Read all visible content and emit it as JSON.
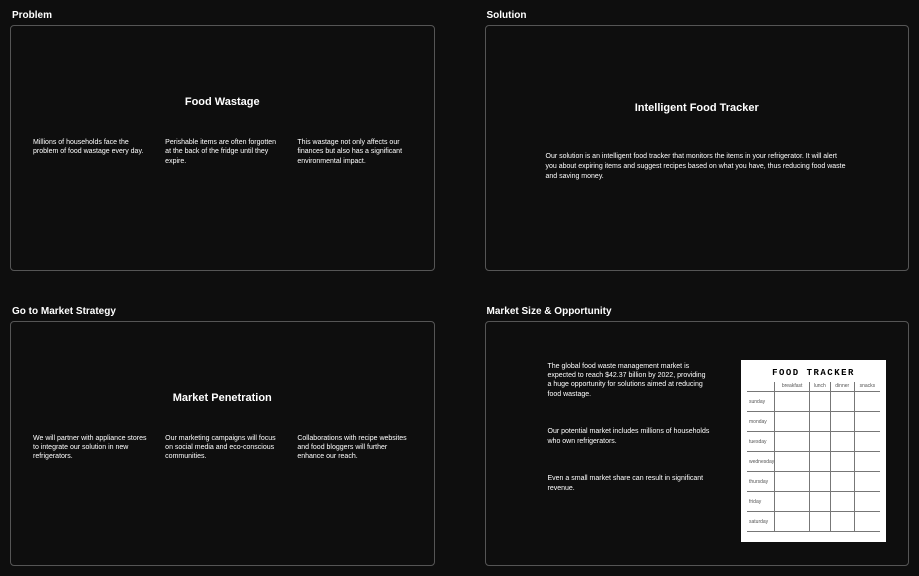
{
  "sections": {
    "problem": {
      "label": "Problem",
      "heading": "Food Wastage",
      "cols": [
        "Millions of households face the problem of food wastage every day.",
        "Perishable items are often forgotten at the back of the fridge until they expire.",
        "This wastage not only affects our finances but also has a significant environmental impact."
      ]
    },
    "solution": {
      "label": "Solution",
      "heading": "Intelligent Food Tracker",
      "body": "Our solution is an intelligent food tracker that monitors the items in your refrigerator. It will alert you about expiring items and suggest recipes based on what you have, thus reducing food waste and saving money."
    },
    "strategy": {
      "label": "Go to Market Strategy",
      "heading": "Market Penetration",
      "cols": [
        "We will partner with appliance stores to integrate our solution in new refrigerators.",
        "Our marketing campaigns will focus on social media and eco-conscious communities.",
        "Collaborations with recipe websites and food bloggers will further enhance our reach."
      ]
    },
    "market": {
      "label": "Market Size & Opportunity",
      "paras": [
        "The global food waste management market is expected to reach $42.37 billion by 2022, providing a huge opportunity for solutions aimed at reducing food wastage.",
        "Our potential market includes millions of households who own refrigerators.",
        "Even a small market share can result in significant revenue."
      ],
      "tracker": {
        "title": "FOOD TRACKER",
        "headers": [
          "",
          "breakfast",
          "lunch",
          "dinner",
          "snacks"
        ],
        "rows": [
          "sunday",
          "monday",
          "tuesday",
          "wednesday",
          "thursday",
          "friday",
          "saturday"
        ]
      }
    }
  }
}
